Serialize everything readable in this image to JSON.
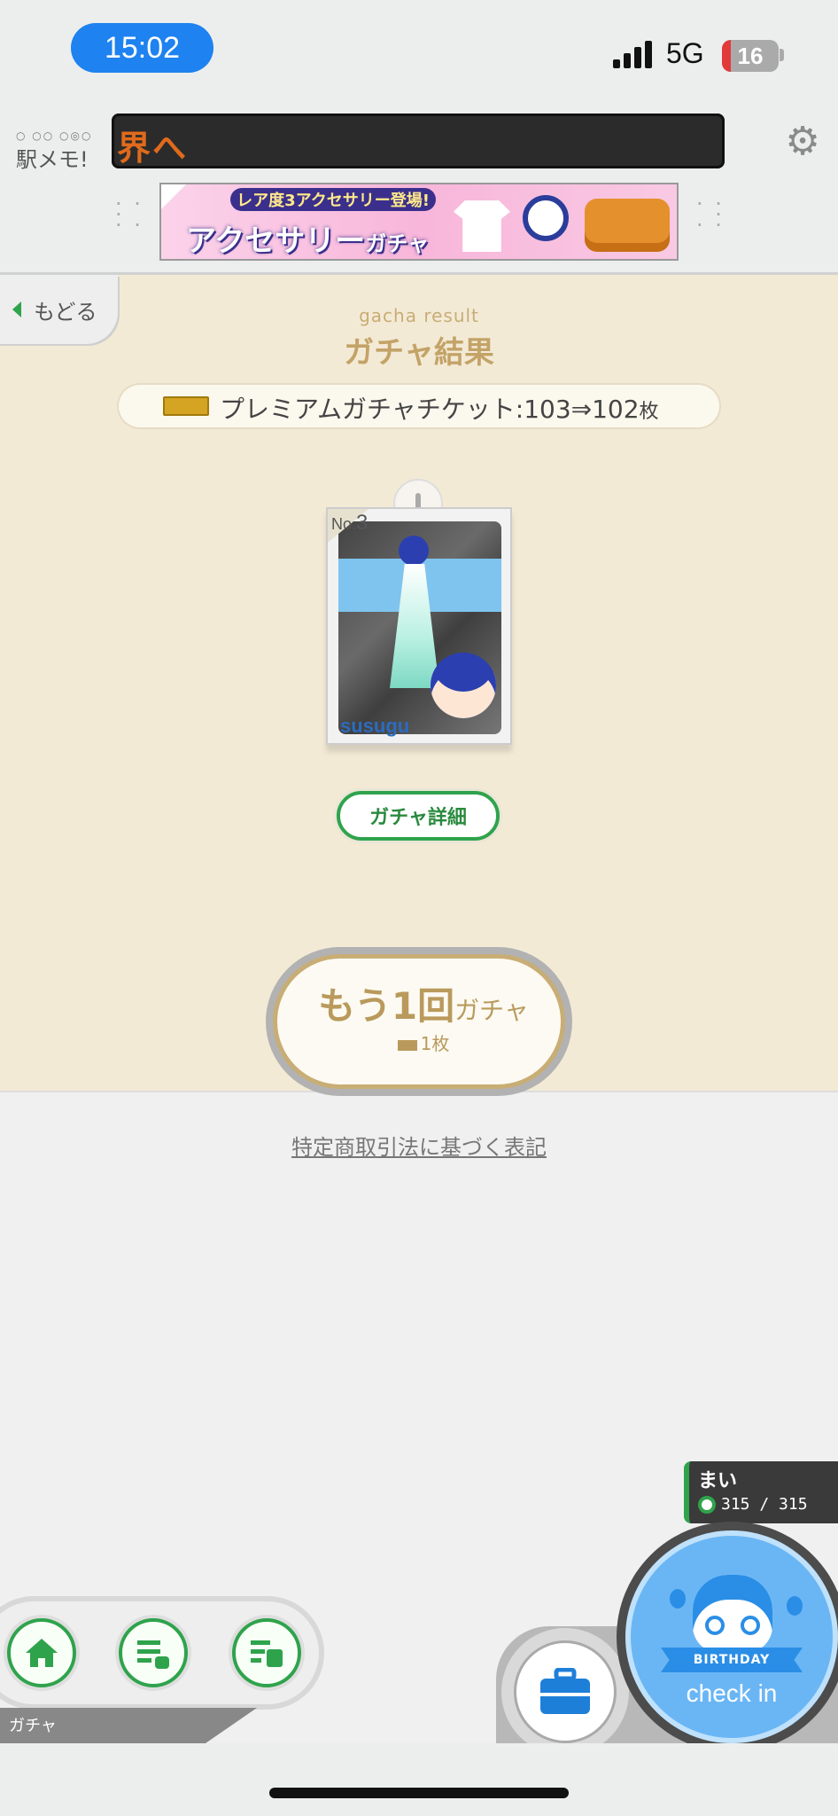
{
  "status_bar": {
    "time": "15:02",
    "network": "5G",
    "battery": "16",
    "battery_level": 0.16,
    "signal_icon": "signal-bars-icon"
  },
  "header": {
    "logo_text": "駅メモ!",
    "logo_dots": "○ ○○ ○◎○",
    "ticker_text": "界へ",
    "ticker_color": "#e06a1c",
    "settings_icon": "gear-icon",
    "banner": {
      "top_text": "レア度3アクセサリー登場!",
      "main_text": "アクセサリー",
      "sub_text": "ガチャ"
    }
  },
  "main": {
    "back_label": "もどる",
    "subtitle": "gacha result",
    "title": "ガチャ結果",
    "ticket_text": "プレミアムガチャチケット:103⇒102",
    "ticket_unit": "枚",
    "card": {
      "number_prefix": "No.",
      "number": "3",
      "name": "susugu"
    },
    "detail_button": "ガチャ詳細",
    "again_button": {
      "main": "もう1回",
      "suffix": "ガチャ",
      "cost": "1枚"
    }
  },
  "footer": {
    "legal_link": "特定商取引法に基づく表記"
  },
  "player": {
    "name": "まい",
    "hp": "315 / 315"
  },
  "bottom_nav": {
    "label": "ガチャ",
    "buttons": [
      "home-icon",
      "station-list-icon",
      "train-list-icon"
    ],
    "bag_icon": "briefcase-icon",
    "checkin_ribbon": "BIRTHDAY",
    "checkin_label": "check in"
  },
  "colors": {
    "accent_green": "#2fa34c",
    "gold": "#c3a367",
    "checkin_blue": "#6ab6f5",
    "time_pill": "#1e82f0"
  }
}
